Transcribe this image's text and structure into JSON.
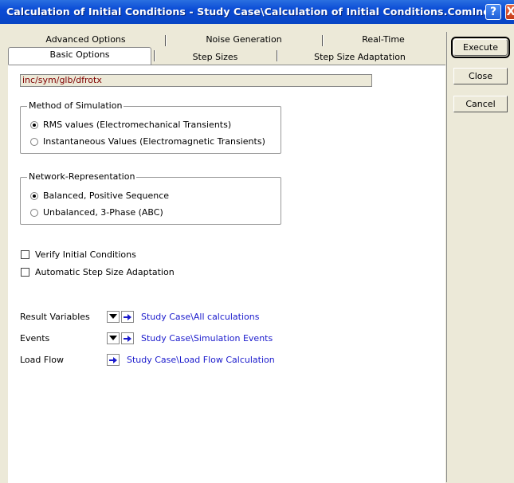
{
  "window": {
    "title": "Calculation of Initial Conditions - Study Case\\Calculation of Initial Conditions.ComInc",
    "help_glyph": "?",
    "close_glyph": "X"
  },
  "tabs": {
    "row1": [
      "Advanced Options",
      "Noise Generation",
      "Real-Time"
    ],
    "row2": [
      "Basic Options",
      "Step Sizes",
      "Step Size Adaptation"
    ]
  },
  "path_value": "inc/sym/glb/dfrotx",
  "method": {
    "title": "Method of Simulation",
    "options": [
      "RMS values (Electromechanical Transients)",
      "Instantaneous Values (Electromagnetic Transients)"
    ],
    "selected": 0
  },
  "network": {
    "title": "Network-Representation",
    "options": [
      "Balanced, Positive Sequence",
      "Unbalanced, 3-Phase (ABC)"
    ],
    "selected": 0
  },
  "checks": [
    {
      "label": "Verify Initial Conditions",
      "checked": false
    },
    {
      "label": "Automatic Step Size Adaptation",
      "checked": false
    }
  ],
  "refs": [
    {
      "label": "Result Variables",
      "link": "Study Case\\All calculations"
    },
    {
      "label": "Events",
      "link": "Study Case\\Simulation Events"
    },
    {
      "label": "Load Flow",
      "link": "Study Case\\Load Flow Calculation"
    }
  ],
  "buttons": {
    "execute": "Execute",
    "close": "Close",
    "cancel": "Cancel"
  }
}
